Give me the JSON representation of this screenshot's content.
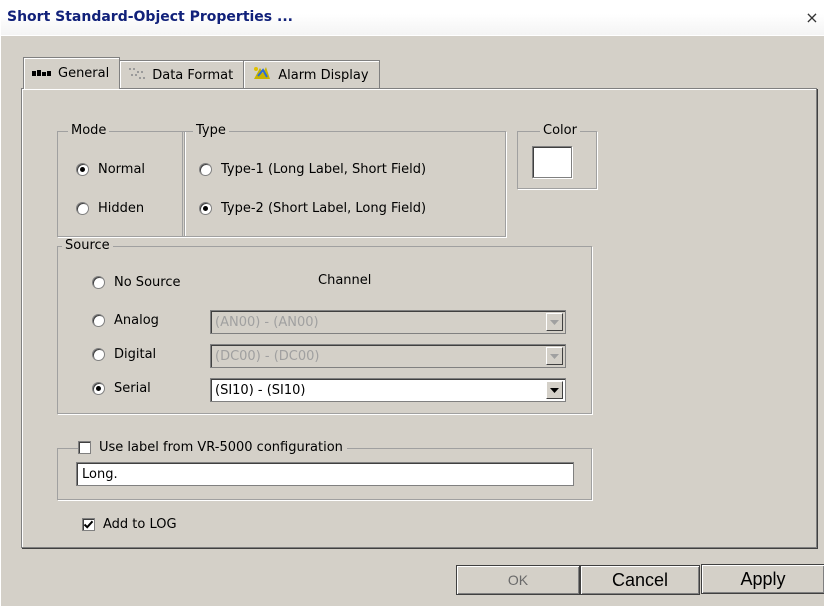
{
  "window": {
    "title": "Short Standard-Object Properties ...",
    "close_glyph": "×"
  },
  "tabs": [
    {
      "label": "General",
      "icon": "general-tab-icon",
      "active": true
    },
    {
      "label": "Data Format",
      "icon": "data-format-icon",
      "active": false
    },
    {
      "label": "Alarm Display",
      "icon": "alarm-icon",
      "active": false
    }
  ],
  "mode": {
    "legend": "Mode",
    "options": [
      {
        "label": "Normal",
        "selected": true
      },
      {
        "label": "Hidden",
        "selected": false
      }
    ]
  },
  "type": {
    "legend": "Type",
    "options": [
      {
        "label": "Type-1 (Long Label, Short Field)",
        "selected": false
      },
      {
        "label": "Type-2 (Short Label, Long Field)",
        "selected": true
      }
    ]
  },
  "color": {
    "legend": "Color",
    "value": "#ffffff"
  },
  "source": {
    "legend": "Source",
    "channel_label": "Channel",
    "options": [
      {
        "label": "No Source",
        "selected": false
      },
      {
        "label": "Analog",
        "selected": false,
        "channel": "(AN00) - (AN00)",
        "enabled": false
      },
      {
        "label": "Digital",
        "selected": false,
        "channel": "(DC00) - (DC00)",
        "enabled": false
      },
      {
        "label": "Serial",
        "selected": true,
        "channel": "(SI10) - (SI10)",
        "enabled": true
      }
    ]
  },
  "label_group": {
    "checkbox_label": "Use label from VR-5000 configuration",
    "checked": false,
    "value": "Long."
  },
  "log": {
    "label": "Add to LOG",
    "checked": true
  },
  "buttons": {
    "ok": "OK",
    "cancel": "Cancel",
    "apply": "Apply"
  }
}
